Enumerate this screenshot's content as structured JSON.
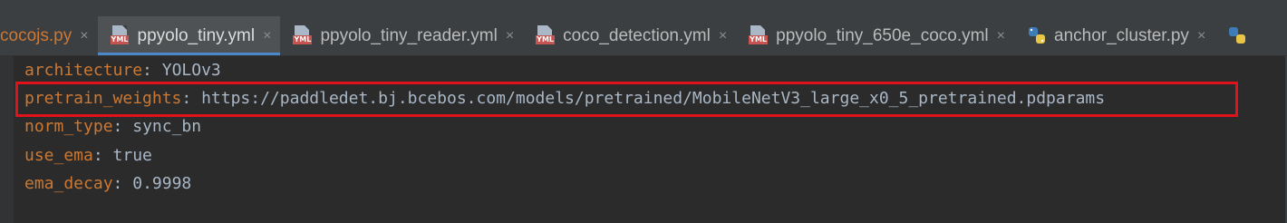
{
  "tabs": [
    {
      "label": "cocojs.py",
      "icon": "python-file-icon",
      "active": false
    },
    {
      "label": "ppyolo_tiny.yml",
      "icon": "yml-file-icon",
      "active": true
    },
    {
      "label": "ppyolo_tiny_reader.yml",
      "icon": "yml-file-icon",
      "active": false
    },
    {
      "label": "coco_detection.yml",
      "icon": "yml-file-icon",
      "active": false
    },
    {
      "label": "ppyolo_tiny_650e_coco.yml",
      "icon": "yml-file-icon",
      "active": false
    },
    {
      "label": "anchor_cluster.py",
      "icon": "python-file-icon",
      "active": false
    }
  ],
  "close_glyph": "×",
  "yml_badge": "YML",
  "editor": {
    "lines": [
      {
        "key": "architecture",
        "sep": ": ",
        "value": "YOLOv3"
      },
      {
        "key": "pretrain_weights",
        "sep": ": ",
        "value": "https://paddledet.bj.bcebos.com/models/pretrained/MobileNetV3_large_x0_5_pretrained.pdparams"
      },
      {
        "key": "norm_type",
        "sep": ": ",
        "value": "sync_bn"
      },
      {
        "key": "use_ema",
        "sep": ": ",
        "value": "true"
      },
      {
        "key": "ema_decay",
        "sep": ": ",
        "value": "0.9998"
      }
    ]
  },
  "colors": {
    "key": "#cc7832",
    "value": "#a9b7c6",
    "highlight_box": "#e0121b",
    "active_tab_underline": "#4a88c7"
  }
}
